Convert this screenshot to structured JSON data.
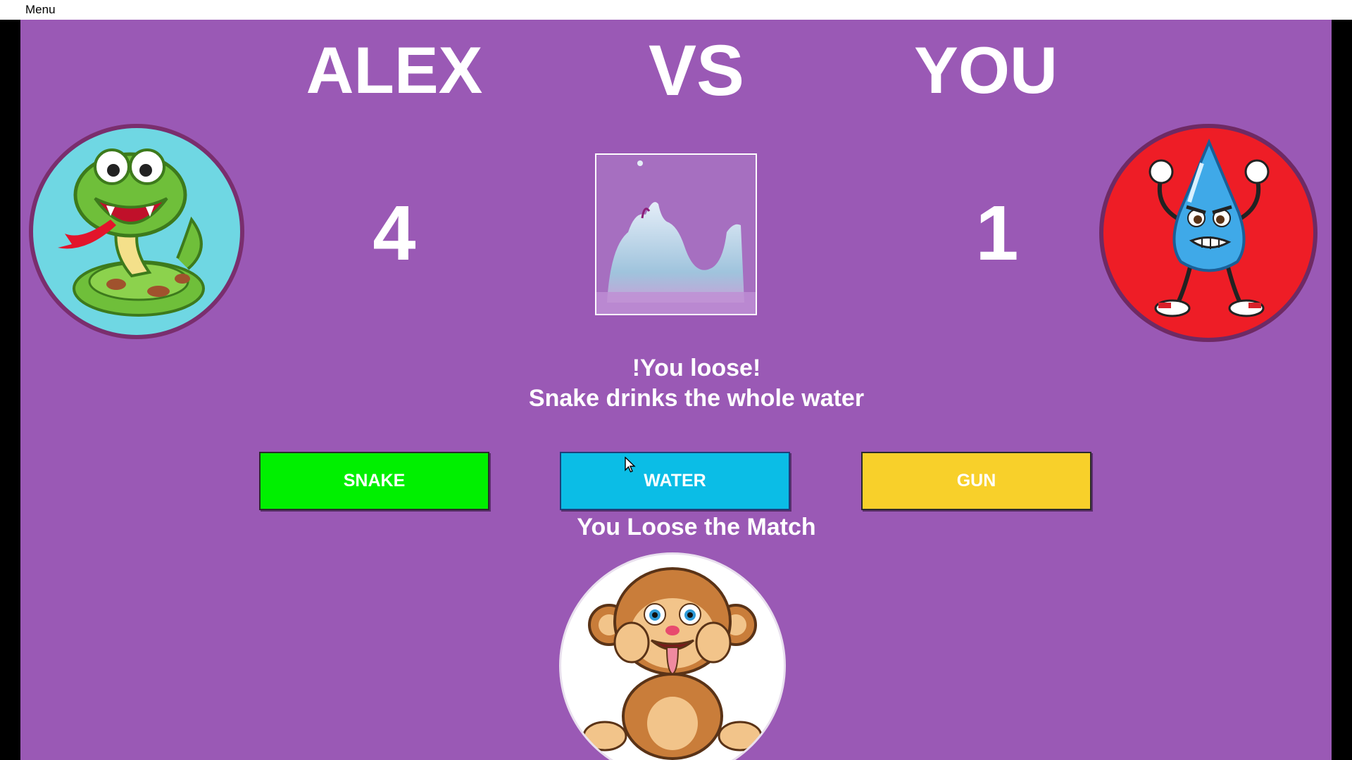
{
  "menubar": {
    "menu_label": "Menu"
  },
  "players": {
    "left_name": "ALEX",
    "versus": "VS",
    "right_name": "YOU",
    "left_score": "4",
    "right_score": "1"
  },
  "result": {
    "line1": "!You loose!",
    "line2": "Snake drinks the whole water",
    "match_result": "You Loose the Match"
  },
  "buttons": {
    "snake": "SNAKE",
    "water": "WATER",
    "gun": "GUN"
  },
  "colors": {
    "background": "#9a59b5",
    "snake_button": "#00f000",
    "water_button": "#0bbde6",
    "gun_button": "#f8d02a",
    "right_avatar_bg": "#ee1d26",
    "left_avatar_bg": "#6fd7e3"
  },
  "images": {
    "left_avatar": "snake-character",
    "right_avatar": "angry-water-drop-character",
    "center": "water-splash",
    "bottom": "monkey-teasing-character"
  }
}
